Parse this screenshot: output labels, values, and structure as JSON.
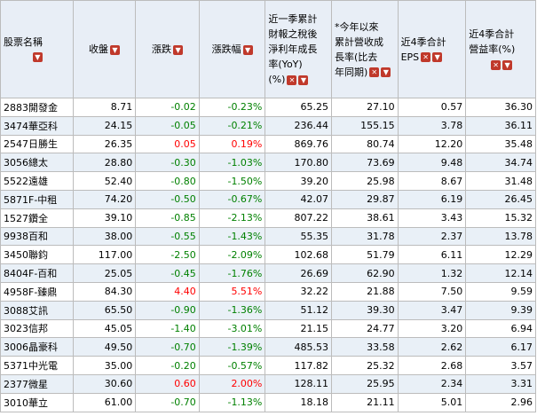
{
  "headers": {
    "name": "股票名稱",
    "close": "收盤",
    "change": "漲跌",
    "change_pct": "漲跌幅",
    "growth": [
      "近一季累計",
      "財報之稅後",
      "淨利年成長",
      "率(YoY)",
      "(%)"
    ],
    "rev": [
      "*今年以來",
      "累計營收成",
      "長率(比去",
      "年同期)"
    ],
    "eps": [
      "近4季合計",
      "EPS"
    ],
    "margin": [
      "近4季合計",
      "營益率(%)"
    ]
  },
  "icons": {
    "sort_down": "arrow-down-icon",
    "sort_remove": "close-icon"
  },
  "colors": {
    "header_bg": "#e8eef6",
    "alt_row_bg": "#e9f0f7",
    "negative": "#008000",
    "positive": "#ff0000",
    "icon_red": "#c0392b"
  },
  "rows": [
    {
      "name": "2883開發金",
      "close": "8.71",
      "change": "-0.02",
      "pct": "-0.23%",
      "growth": "65.25",
      "rev": "27.10",
      "eps": "0.57",
      "margin": "36.30",
      "dir": "neg"
    },
    {
      "name": "3474華亞科",
      "close": "24.15",
      "change": "-0.05",
      "pct": "-0.21%",
      "growth": "236.44",
      "rev": "155.15",
      "eps": "3.78",
      "margin": "36.11",
      "dir": "neg"
    },
    {
      "name": "2547日勝生",
      "close": "26.35",
      "change": "0.05",
      "pct": "0.19%",
      "growth": "869.76",
      "rev": "80.74",
      "eps": "12.20",
      "margin": "35.48",
      "dir": "pos"
    },
    {
      "name": "3056總太",
      "close": "28.80",
      "change": "-0.30",
      "pct": "-1.03%",
      "growth": "170.80",
      "rev": "73.69",
      "eps": "9.48",
      "margin": "34.74",
      "dir": "neg"
    },
    {
      "name": "5522遠雄",
      "close": "52.40",
      "change": "-0.80",
      "pct": "-1.50%",
      "growth": "39.20",
      "rev": "25.98",
      "eps": "8.67",
      "margin": "31.48",
      "dir": "neg"
    },
    {
      "name": "5871F-中租",
      "close": "74.20",
      "change": "-0.50",
      "pct": "-0.67%",
      "growth": "42.07",
      "rev": "29.87",
      "eps": "6.19",
      "margin": "26.45",
      "dir": "neg"
    },
    {
      "name": "1527鑽全",
      "close": "39.10",
      "change": "-0.85",
      "pct": "-2.13%",
      "growth": "807.22",
      "rev": "38.61",
      "eps": "3.43",
      "margin": "15.32",
      "dir": "neg"
    },
    {
      "name": "9938百和",
      "close": "38.00",
      "change": "-0.55",
      "pct": "-1.43%",
      "growth": "55.35",
      "rev": "31.78",
      "eps": "2.37",
      "margin": "13.78",
      "dir": "neg"
    },
    {
      "name": "3450聯鈞",
      "close": "117.00",
      "change": "-2.50",
      "pct": "-2.09%",
      "growth": "102.68",
      "rev": "51.79",
      "eps": "6.11",
      "margin": "12.29",
      "dir": "neg"
    },
    {
      "name": "8404F-百和",
      "close": "25.05",
      "change": "-0.45",
      "pct": "-1.76%",
      "growth": "26.69",
      "rev": "62.90",
      "eps": "1.32",
      "margin": "12.14",
      "dir": "neg"
    },
    {
      "name": "4958F-臻鼎",
      "close": "84.30",
      "change": "4.40",
      "pct": "5.51%",
      "growth": "32.22",
      "rev": "21.88",
      "eps": "7.50",
      "margin": "9.59",
      "dir": "pos"
    },
    {
      "name": "3088艾訊",
      "close": "65.50",
      "change": "-0.90",
      "pct": "-1.36%",
      "growth": "51.12",
      "rev": "39.30",
      "eps": "3.47",
      "margin": "9.39",
      "dir": "neg"
    },
    {
      "name": "3023信邦",
      "close": "45.05",
      "change": "-1.40",
      "pct": "-3.01%",
      "growth": "21.15",
      "rev": "24.77",
      "eps": "3.20",
      "margin": "6.94",
      "dir": "neg"
    },
    {
      "name": "3006晶豪科",
      "close": "49.50",
      "change": "-0.70",
      "pct": "-1.39%",
      "growth": "485.53",
      "rev": "33.58",
      "eps": "2.62",
      "margin": "6.17",
      "dir": "neg"
    },
    {
      "name": "5371中光電",
      "close": "35.00",
      "change": "-0.20",
      "pct": "-0.57%",
      "growth": "117.82",
      "rev": "25.32",
      "eps": "2.68",
      "margin": "3.57",
      "dir": "neg"
    },
    {
      "name": "2377微星",
      "close": "30.60",
      "change": "0.60",
      "pct": "2.00%",
      "growth": "128.11",
      "rev": "25.95",
      "eps": "2.34",
      "margin": "3.31",
      "dir": "pos"
    },
    {
      "name": "3010華立",
      "close": "61.00",
      "change": "-0.70",
      "pct": "-1.13%",
      "growth": "18.18",
      "rev": "21.11",
      "eps": "5.01",
      "margin": "2.96",
      "dir": "neg"
    }
  ]
}
